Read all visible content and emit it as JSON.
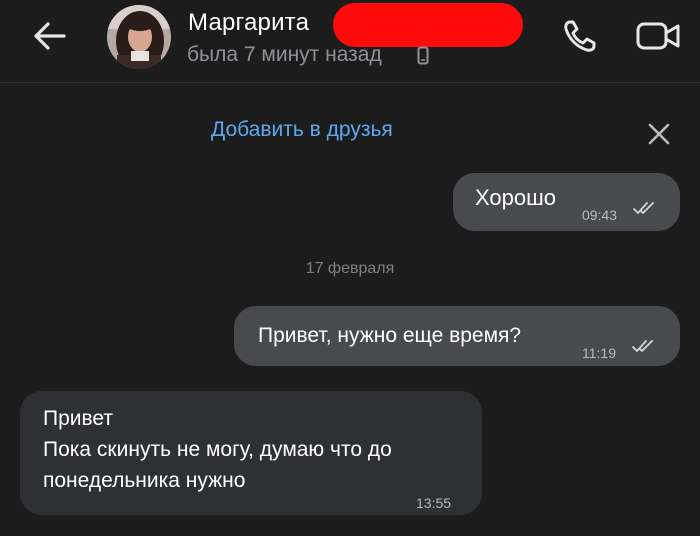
{
  "header": {
    "name": "Маргарита",
    "status": "была 7 минут назад",
    "icons": {
      "back": "arrow-left-icon",
      "call": "phone-icon",
      "video": "video-camera-icon",
      "device": "mobile-phone-icon"
    }
  },
  "add_friend": {
    "label": "Добавить в друзья",
    "dismiss_icon": "close-icon"
  },
  "messages": [
    {
      "direction": "outgoing",
      "text": "Хорошо",
      "time": "09:43",
      "status": "read"
    },
    {
      "direction": "outgoing",
      "text": "Привет, нужно еще время?",
      "time": "11:19",
      "status": "read"
    },
    {
      "direction": "incoming",
      "text": "Привет\nПока скинуть не могу, думаю что до понедельника нужно",
      "time": "13:55"
    }
  ],
  "date_separator": "17 февраля",
  "colors": {
    "background": "#1c1c1d",
    "outgoing_bubble": "#484a4e",
    "incoming_bubble": "#2e3033",
    "accent": "#5ea8f0",
    "redaction": "#ff0a0a"
  }
}
